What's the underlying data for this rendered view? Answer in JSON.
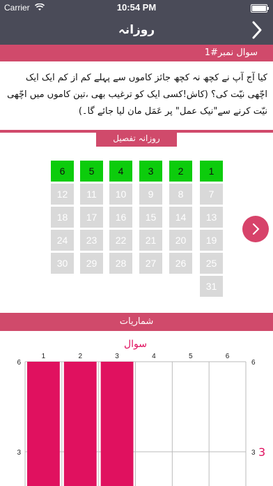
{
  "status_bar": {
    "carrier": "Carrier",
    "time": "10:54 PM"
  },
  "navbar": {
    "title": "روزانہ"
  },
  "question": {
    "header": "سوال نمبر#1",
    "text": "کیا آج آپ نے کچھ نہ کچھ جائز کاموں سے پہلے کم از کم ایک ایک اچّھی نیّت کی؟ (کاش!کسی ایک کو ترغیب بھی ،تین کاموں میں اچّھی نیّت کرنے سے\"نیک عمل\" پر عَمَل مان لیا جائے گا۔)"
  },
  "detail_label": "روزانہ تفصیل",
  "calendar": {
    "days": [
      "1",
      "2",
      "3",
      "4",
      "5",
      "6",
      "7",
      "8",
      "9",
      "10",
      "11",
      "12",
      "13",
      "14",
      "15",
      "16",
      "17",
      "18",
      "19",
      "20",
      "21",
      "22",
      "23",
      "24",
      "25",
      "26",
      "27",
      "28",
      "29",
      "30",
      "31"
    ],
    "active_days": 6
  },
  "stats_label": "شماریات",
  "colors": {
    "accent": "#d04a6b",
    "active_day": "#0ccc0c",
    "inactive_day": "#d9d9d9",
    "bar": "#e0115f",
    "navbar": "#4a4b58"
  },
  "chart_data": {
    "type": "bar",
    "title": "سوال",
    "categories": [
      "1",
      "2",
      "3",
      "4",
      "5",
      "6"
    ],
    "values": [
      6,
      6,
      6,
      0,
      0,
      0
    ],
    "top_tick_labels": [
      "1",
      "2",
      "3",
      "4",
      "5",
      "6"
    ],
    "ylim": [
      0,
      6
    ],
    "left_ticks": [
      "6",
      "3"
    ],
    "right_ticks": [
      "6",
      "3"
    ],
    "right_annotation": "3",
    "grid": true
  }
}
